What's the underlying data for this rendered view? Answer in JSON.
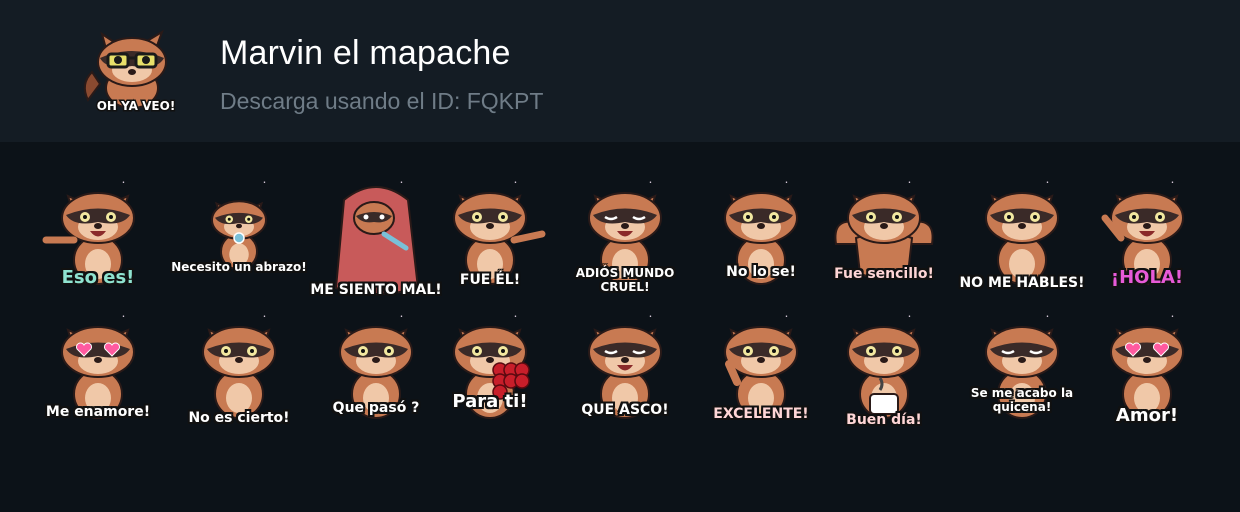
{
  "pack": {
    "title": "Marvin el mapache",
    "subtitle": "Descarga usando el ID: FQKPT",
    "thumbnail_caption": "OH YA VEO!"
  },
  "colors": {
    "header_bg": "#141c24",
    "page_bg": "#0c1218",
    "fur": "#c87a52",
    "fur_light": "#f0c8a8",
    "mask": "#3a2a28"
  },
  "stickers": [
    {
      "caption": "Eso es!",
      "color": "#8fe3d0",
      "pose": "pointing"
    },
    {
      "caption": "Necesito un abrazo!",
      "color": "#ffffff",
      "pose": "pacifier"
    },
    {
      "caption": "ME SIENTO MAL!",
      "color": "#ffffff",
      "pose": "blanket"
    },
    {
      "caption": "FUE ÉL!",
      "color": "#ffffff",
      "pose": "pointing-right"
    },
    {
      "caption": "ADIÓS MUNDO CRUEL!",
      "color": "#ffffff",
      "pose": "crying"
    },
    {
      "caption": "No lo se!",
      "color": "#ffffff",
      "pose": "shrug"
    },
    {
      "caption": "Fue sencillo!",
      "color": "#ffd6d6",
      "pose": "muscles"
    },
    {
      "caption": "NO ME HABLES!",
      "color": "#ffffff",
      "pose": "annoyed"
    },
    {
      "caption": "¡HOLA!",
      "color": "#e75ad8",
      "pose": "waving"
    },
    {
      "caption": "Me enamore!",
      "color": "#ffffff",
      "pose": "heart-eyes"
    },
    {
      "caption": "No es cierto!",
      "color": "#ffffff",
      "pose": "arms-crossed"
    },
    {
      "caption": "Que pasó ?",
      "color": "#ffffff",
      "pose": "confused"
    },
    {
      "caption": "Para ti!",
      "color": "#ffffff",
      "pose": "roses"
    },
    {
      "caption": "QUE ASCO!",
      "color": "#ffffff",
      "pose": "disgust"
    },
    {
      "caption": "EXCELENTE!",
      "color": "#ffd6d6",
      "pose": "thumbs-up"
    },
    {
      "caption": "Buen día!",
      "color": "#ffd6d6",
      "pose": "coffee"
    },
    {
      "caption": "Se me acabo la quicena!",
      "color": "#ffffff",
      "pose": "sad"
    },
    {
      "caption": "Amor!",
      "color": "#ffffff",
      "pose": "heart-eyes"
    }
  ]
}
